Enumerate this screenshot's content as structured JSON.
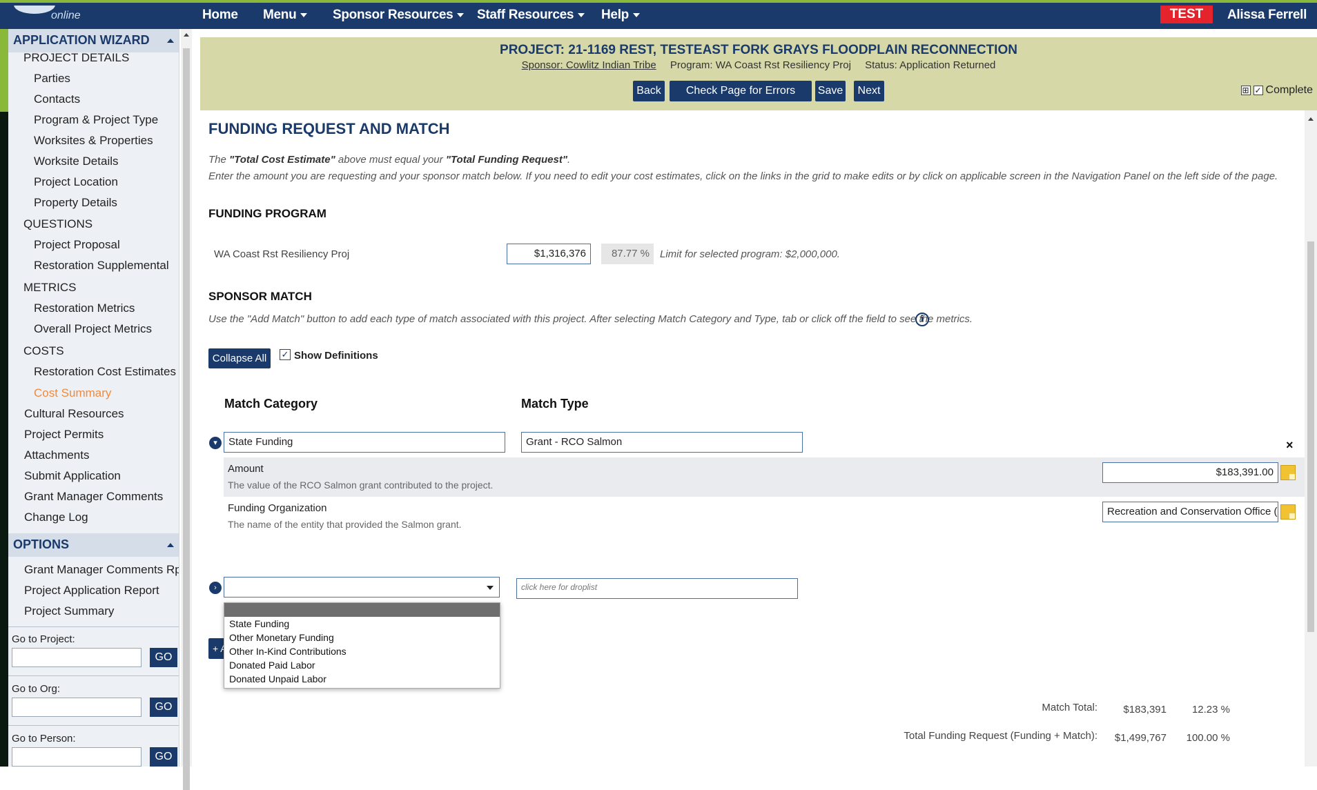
{
  "nav": {
    "logo_sub": "online",
    "items": [
      {
        "label": "Home",
        "dropdown": false
      },
      {
        "label": "Menu",
        "dropdown": true
      },
      {
        "label": "Sponsor Resources",
        "dropdown": true
      },
      {
        "label": "Staff Resources",
        "dropdown": true
      },
      {
        "label": "Help",
        "dropdown": true
      }
    ],
    "env_badge": "TEST",
    "user": "Alissa Ferrell"
  },
  "sidebar": {
    "wizard_title": "APPLICATION WIZARD",
    "items": [
      {
        "label": "PROJECT DETAILS",
        "level": 0
      },
      {
        "label": "Parties",
        "level": 1
      },
      {
        "label": "Contacts",
        "level": 1
      },
      {
        "label": "Program & Project Type",
        "level": 1
      },
      {
        "label": "Worksites & Properties",
        "level": 1
      },
      {
        "label": "Worksite Details",
        "level": 1
      },
      {
        "label": "Project Location",
        "level": 1
      },
      {
        "label": "Property Details",
        "level": 1
      },
      {
        "label": "QUESTIONS",
        "level": 0
      },
      {
        "label": "Project Proposal",
        "level": 1
      },
      {
        "label": "Restoration Supplemental",
        "level": 1
      },
      {
        "label": "METRICS",
        "level": 0
      },
      {
        "label": "Restoration Metrics",
        "level": 1
      },
      {
        "label": "Overall Project Metrics",
        "level": 1
      },
      {
        "label": "COSTS",
        "level": 0
      },
      {
        "label": "Restoration Cost Estimates",
        "level": 1
      },
      {
        "label": "Cost Summary",
        "level": 1,
        "active": true
      },
      {
        "label": "Cultural Resources",
        "level": 0
      },
      {
        "label": "Project Permits",
        "level": 0
      },
      {
        "label": "Attachments",
        "level": 0
      },
      {
        "label": "Submit Application",
        "level": 0
      },
      {
        "label": "Grant Manager Comments",
        "level": 0
      },
      {
        "label": "Change Log",
        "level": 0
      }
    ],
    "options_title": "OPTIONS",
    "options": [
      "Grant Manager Comments Rpt",
      "Project Application Report",
      "Project Summary"
    ],
    "go_to": [
      {
        "label": "Go to Project:",
        "button": "GO"
      },
      {
        "label": "Go to Org:",
        "button": "GO"
      },
      {
        "label": "Go to Person:",
        "button": "GO"
      }
    ]
  },
  "project": {
    "title": "PROJECT: 21-1169 REST, TESTEAST FORK GRAYS FLOODPLAIN RECONNECTION",
    "sponsor": "Sponsor: Cowlitz Indian Tribe",
    "program": "Program: WA Coast Rst Resiliency Proj",
    "status": "Status: Application Returned",
    "buttons": {
      "back": "Back",
      "check": "Check Page for Errors",
      "save": "Save",
      "next": "Next"
    },
    "complete_label": "Complete",
    "complete_icon": "⊞",
    "check_mark": "✓"
  },
  "page": {
    "title": "FUNDING REQUEST AND MATCH",
    "intro_line1_pre": "The ",
    "intro_line1_b1": "\"Total Cost Estimate\"",
    "intro_line1_mid": " above must equal your ",
    "intro_line1_b2": "\"Total Funding Request\"",
    "intro_line1_end": ".",
    "intro_line2": "Enter the amount you are requesting and your sponsor match below. If you need to edit your cost estimates, click on the links in the grid to make edits or by click on applicable screen in the Navigation Panel on the left side of the page.",
    "funding_program_title": "FUNDING PROGRAM",
    "funding_program": {
      "name": "WA Coast Rst Resiliency Proj",
      "amount": "$1,316,376",
      "percent": "87.77 %",
      "limit_note": "Limit for selected program: $2,000,000."
    },
    "sponsor_match_title": "SPONSOR MATCH",
    "sponsor_match_note": "Use the \"Add Match\" button to add each type of match associated with this project. After selecting Match Category and Type, tab or click off the field to see the metrics.",
    "info_icon": "i",
    "collapse_all": "Collapse All",
    "show_definitions": "Show Definitions",
    "columns": {
      "category": "Match Category",
      "type": "Match Type"
    },
    "match": {
      "category": "State Funding",
      "type": "Grant - RCO Salmon",
      "rows": [
        {
          "label": "Amount",
          "definition": "The value of the RCO Salmon grant contributed to the project.",
          "value": "$183,391.00"
        },
        {
          "label": "Funding Organization",
          "definition": "The name of the entity that provided the Salmon grant.",
          "value": "Recreation and Conservation Office (R"
        }
      ]
    },
    "new_match": {
      "category_value": "",
      "type_placeholder": "click here for droplist",
      "options": [
        "State Funding",
        "Other Monetary Funding",
        "Other In-Kind Contributions",
        "Donated Paid Labor",
        "Donated Unpaid Labor"
      ]
    },
    "add_match_partial": "+ A",
    "totals": {
      "match_label": "Match Total:",
      "match_amount": "$183,391",
      "match_pct": "12.23 %",
      "total_label": "Total Funding Request (Funding + Match):",
      "total_amount": "$1,499,767",
      "total_pct": "100.00 %"
    }
  },
  "icons": {
    "close": "×",
    "expand": "›"
  },
  "colors": {
    "navy": "#1a3a6b",
    "accent_green": "#8ab83a",
    "header_band": "#d6d8a8",
    "active_link": "#f08a3c",
    "test_badge": "#e4232c"
  }
}
